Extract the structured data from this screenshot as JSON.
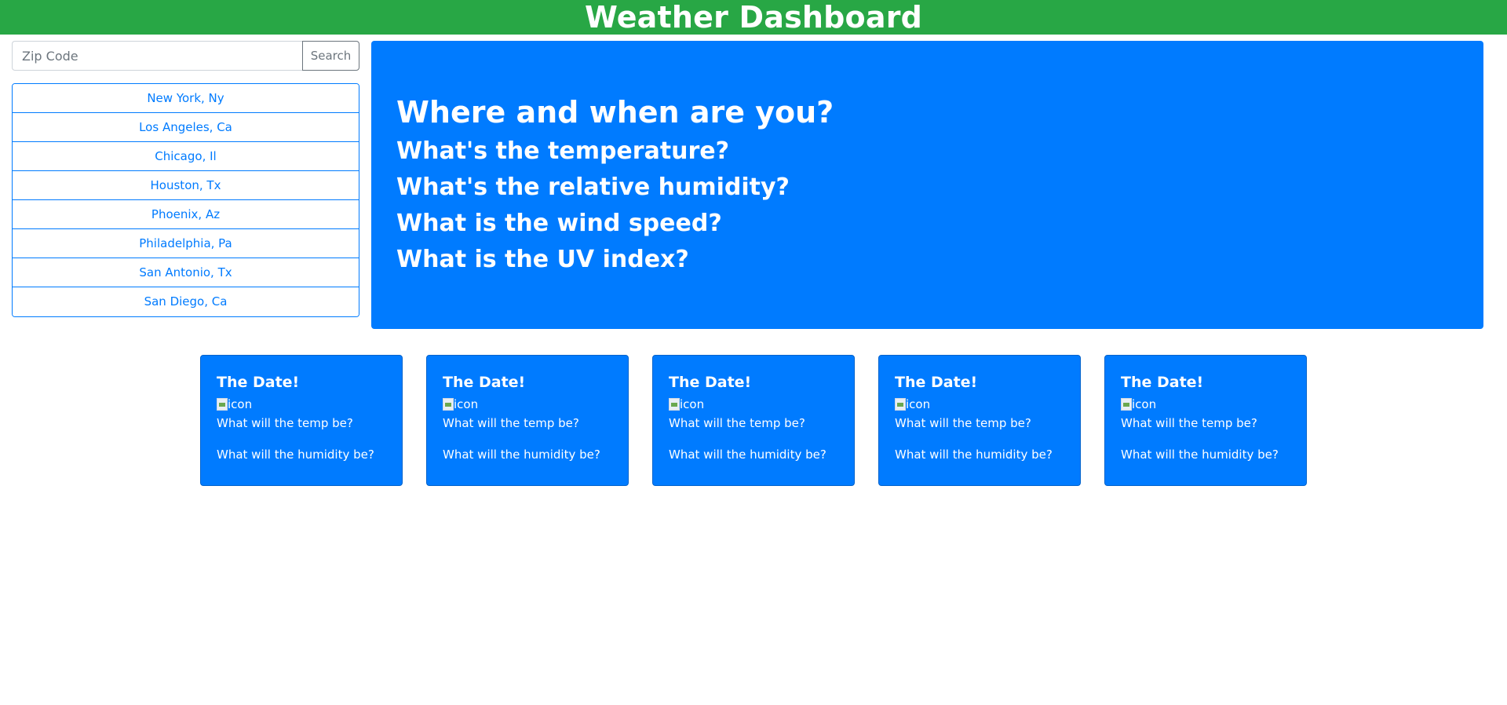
{
  "header": {
    "title": "Weather Dashboard"
  },
  "search": {
    "placeholder": "Zip Code",
    "value": "",
    "button_label": "Search"
  },
  "cities": [
    "New York, Ny",
    "Los Angeles, Ca",
    "Chicago, Il",
    "Houston, Tx",
    "Phoenix, Az",
    "Philadelphia, Pa",
    "San Antonio, Tx",
    "San Diego, Ca"
  ],
  "current": {
    "location_prompt": "Where and when are you?",
    "temperature_prompt": "What's the temperature?",
    "humidity_prompt": "What's the relative humidity?",
    "wind_prompt": "What is the wind speed?",
    "uv_prompt": "What is the UV index?"
  },
  "forecast": [
    {
      "date": "The Date!",
      "icon_alt": "icon",
      "temp": "What will the temp be?",
      "humidity": "What will the humidity be?"
    },
    {
      "date": "The Date!",
      "icon_alt": "icon",
      "temp": "What will the temp be?",
      "humidity": "What will the humidity be?"
    },
    {
      "date": "The Date!",
      "icon_alt": "icon",
      "temp": "What will the temp be?",
      "humidity": "What will the humidity be?"
    },
    {
      "date": "The Date!",
      "icon_alt": "icon",
      "temp": "What will the temp be?",
      "humidity": "What will the humidity be?"
    },
    {
      "date": "The Date!",
      "icon_alt": "icon",
      "temp": "What will the temp be?",
      "humidity": "What will the humidity be?"
    }
  ],
  "colors": {
    "header_bg": "#28a745",
    "primary": "#007bff",
    "text_on_primary": "#ffffff"
  }
}
